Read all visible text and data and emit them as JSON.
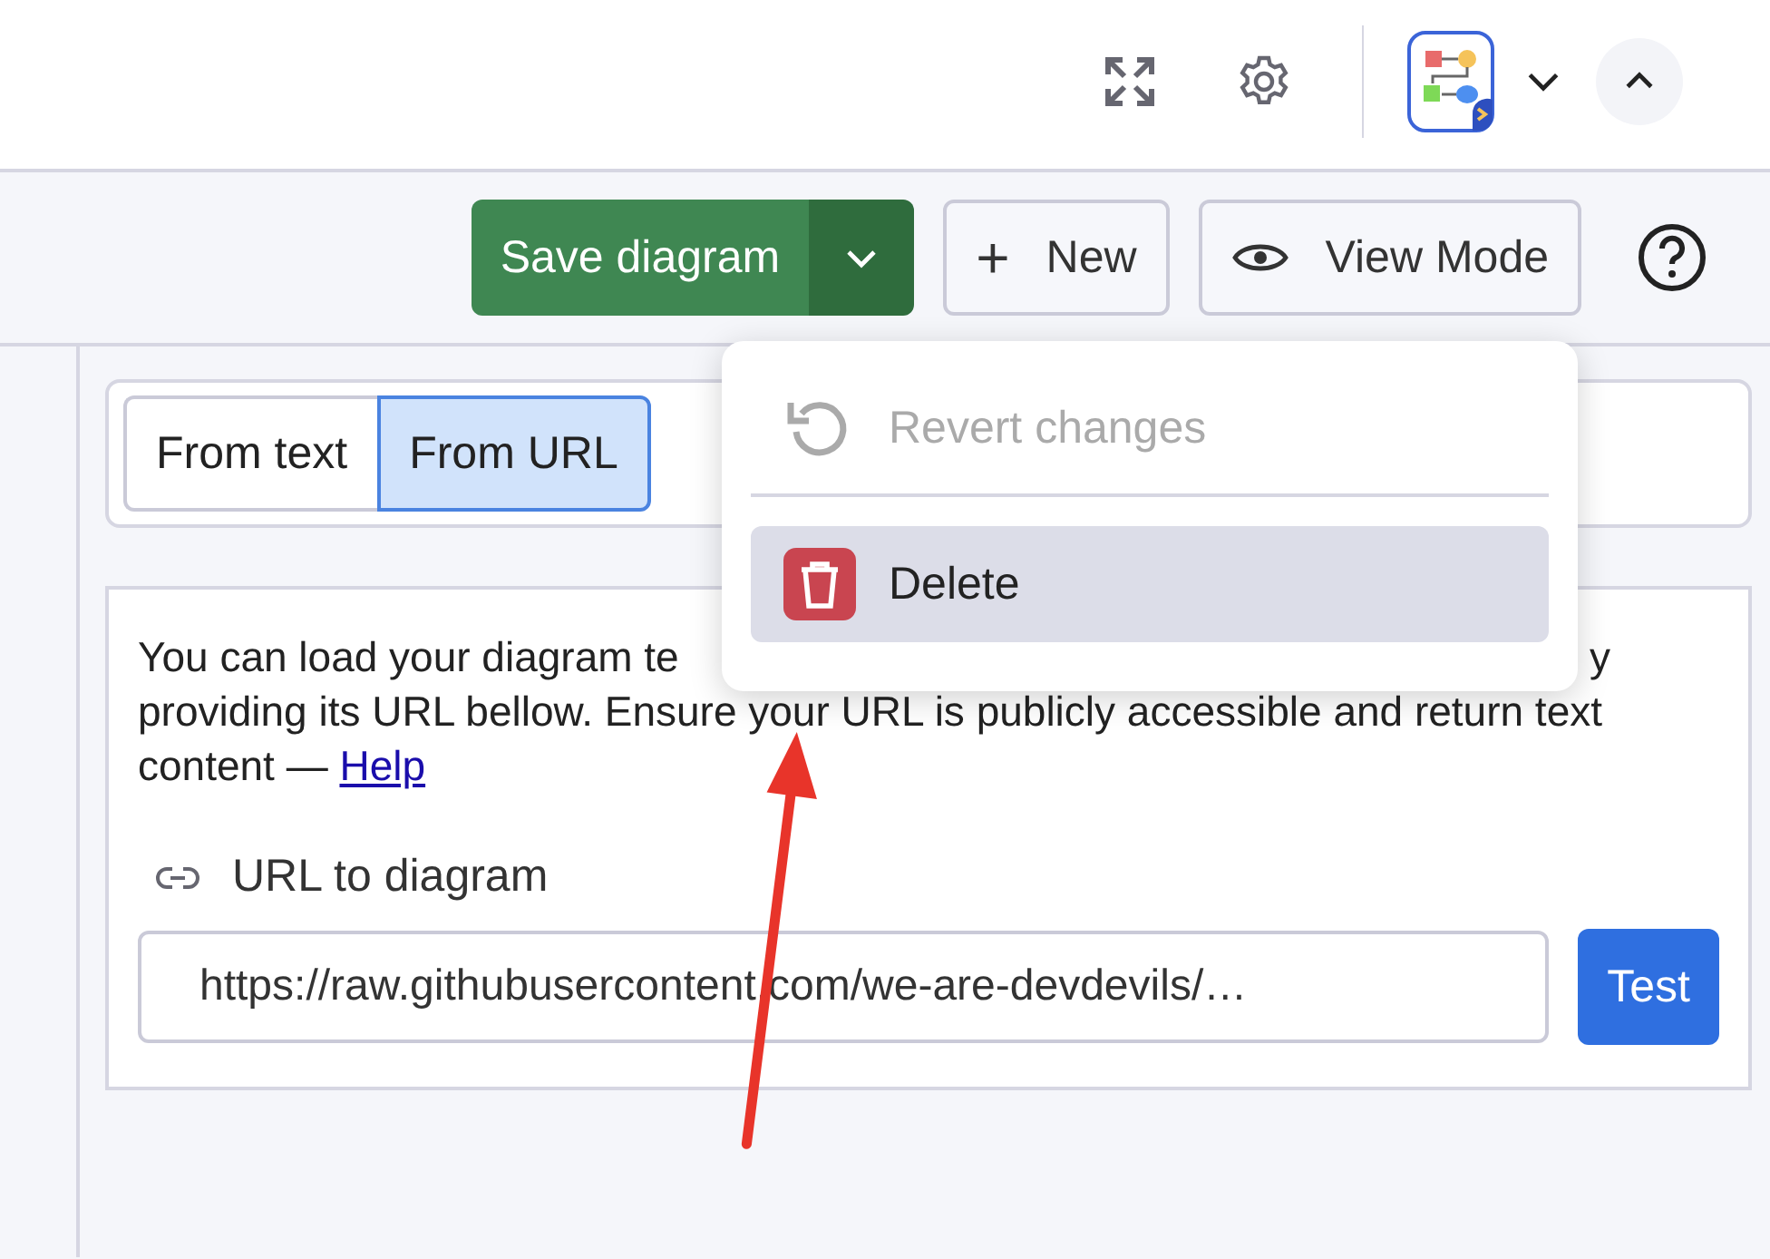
{
  "toolbar": {
    "save_button": "Save diagram",
    "new_button": {
      "icon": "+",
      "label": "New"
    },
    "view_button": "View Mode"
  },
  "source_tabs": [
    {
      "label": "From text",
      "selected": false
    },
    {
      "label": "From URL",
      "selected": true
    }
  ],
  "menu": {
    "items": [
      {
        "kind": "revert",
        "label": "Revert changes",
        "disabled": true,
        "highlighted": false
      },
      {
        "kind": "delete",
        "label": "Delete",
        "disabled": false,
        "highlighted": true
      }
    ]
  },
  "description": {
    "line_start": "You can load your diagram te",
    "line_end": "y",
    "rest": "providing its URL bellow. Ensure your URL is publicly accessible and return text content —",
    "link": "Help"
  },
  "url_field": {
    "label": "URL to diagram",
    "value": "https://raw.githubusercontent.com/we-are-devdevils/…",
    "button": "Test"
  }
}
